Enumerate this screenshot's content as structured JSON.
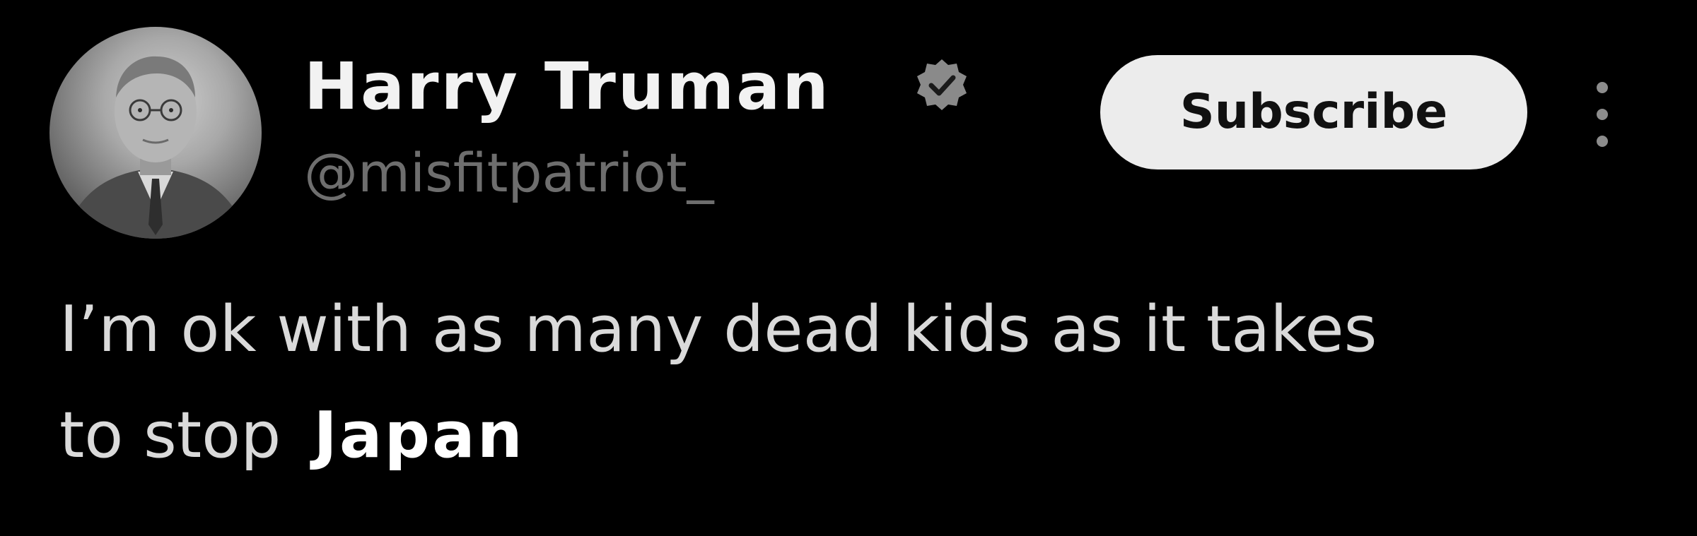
{
  "author": {
    "display_name": "Harry Truman",
    "handle": "@misfitpatriot_",
    "verified": true,
    "avatar_icon": "portrait-avatar"
  },
  "actions": {
    "subscribe_label": "Subscribe",
    "more_icon": "more-vertical-icon"
  },
  "post": {
    "line1": "I’m ok with as many dead kids as it takes",
    "line2": "to stop",
    "overlay_word": "Japan"
  },
  "colors": {
    "background": "#000000",
    "name": "#f2f2f2",
    "handle": "#6e6e6e",
    "body_text": "#dadada",
    "button_bg": "#ececec",
    "verified_badge": "#8a8a8a"
  }
}
